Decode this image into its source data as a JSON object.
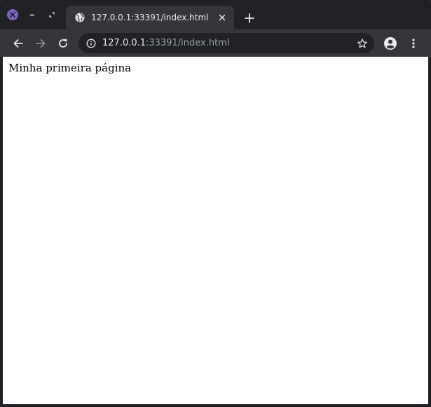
{
  "window": {
    "controls": [
      "close-icon",
      "minimize-icon",
      "maximize-icon"
    ],
    "accent_color": "#7d62c6"
  },
  "tab": {
    "title": "127.0.0.1:33391/index.html",
    "favicon": "globe-icon",
    "close_icon": "close-icon"
  },
  "toolbar": {
    "back_icon": "arrow-left-icon",
    "forward_icon": "arrow-right-icon",
    "reload_icon": "reload-icon",
    "url_host": "127.0.0.1",
    "url_rest": ":33391/index.html",
    "bookmark_icon": "star-icon",
    "profile_icon": "account-icon",
    "menu_icon": "more-vertical-icon"
  },
  "page": {
    "text": "Minha primeira página"
  }
}
